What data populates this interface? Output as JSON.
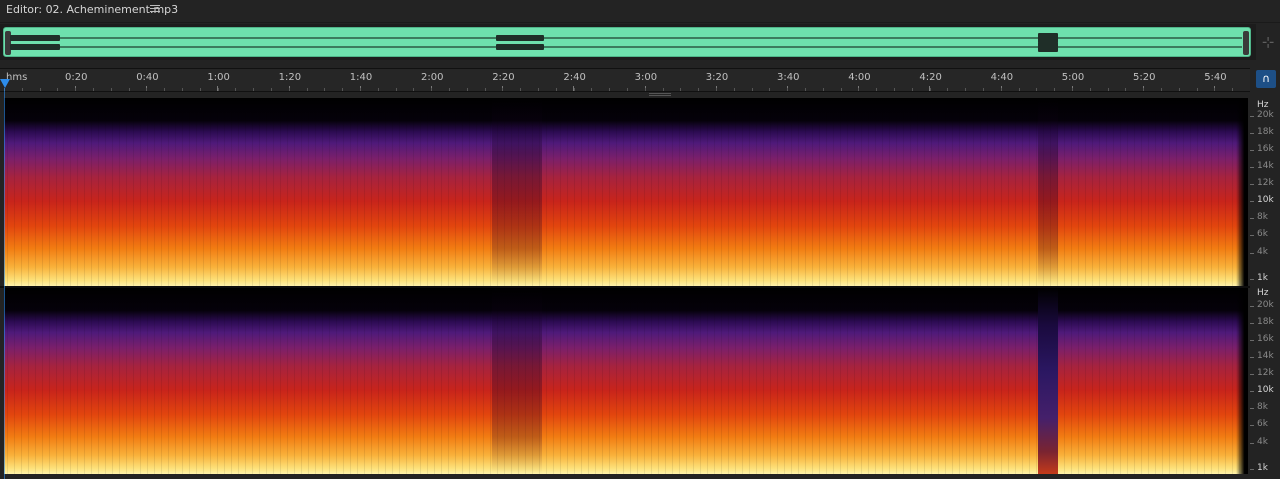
{
  "titlebar": {
    "title": "Editor: 02. Acheminement.mp3",
    "menu_icon": "hamburger-menu-icon"
  },
  "overview": {
    "accent_color": "#6ee0ad",
    "zoom_icon": "zoom-navigator-icon"
  },
  "ruler": {
    "unit_label": "hms",
    "marks": [
      "0:20",
      "0:40",
      "1:00",
      "1:20",
      "1:40",
      "2:00",
      "2:20",
      "2:40",
      "3:00",
      "3:20",
      "3:40",
      "4:00",
      "4:20",
      "4:40",
      "5:00",
      "5:20",
      "5:40"
    ],
    "snap_icon": "magnet-snap-icon",
    "playhead_color": "#2d8ceb"
  },
  "channels": [
    {
      "unit": "Hz",
      "freq_labels": [
        {
          "text": "20k",
          "strong": false
        },
        {
          "text": "18k",
          "strong": false
        },
        {
          "text": "16k",
          "strong": false
        },
        {
          "text": "14k",
          "strong": false
        },
        {
          "text": "12k",
          "strong": false
        },
        {
          "text": "10k",
          "strong": true
        },
        {
          "text": "8k",
          "strong": false
        },
        {
          "text": "6k",
          "strong": false
        },
        {
          "text": "4k",
          "strong": false
        },
        {
          "text": "1k",
          "strong": true
        }
      ]
    },
    {
      "unit": "Hz",
      "freq_labels": [
        {
          "text": "20k",
          "strong": false
        },
        {
          "text": "18k",
          "strong": false
        },
        {
          "text": "16k",
          "strong": false
        },
        {
          "text": "14k",
          "strong": false
        },
        {
          "text": "12k",
          "strong": false
        },
        {
          "text": "10k",
          "strong": true
        },
        {
          "text": "8k",
          "strong": false
        },
        {
          "text": "6k",
          "strong": false
        },
        {
          "text": "4k",
          "strong": false
        },
        {
          "text": "1k",
          "strong": true
        }
      ]
    }
  ]
}
